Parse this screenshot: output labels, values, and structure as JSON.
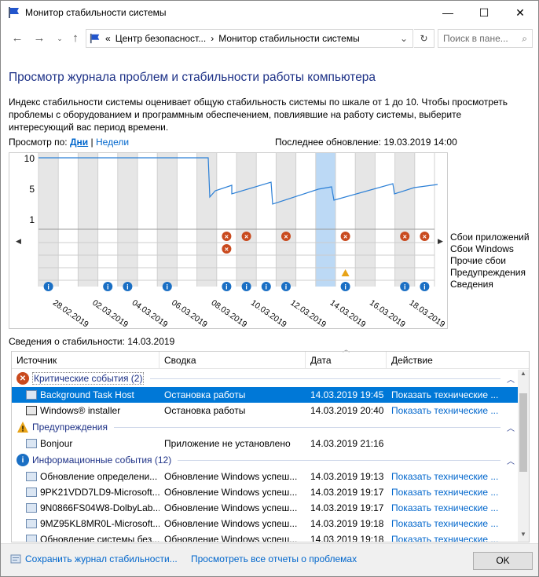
{
  "window": {
    "title": "Монитор стабильности системы"
  },
  "titlebar": {
    "minimize": "—",
    "maximize": "☐",
    "close": "✕"
  },
  "nav": {
    "breadcrumb_sep": "«",
    "crumb1": "Центр безопасност...",
    "crumb2": "Монитор стабильности системы",
    "search_placeholder": "Поиск в пане..."
  },
  "heading": "Просмотр журнала проблем и стабильности работы компьютера",
  "description": "Индекс стабильности системы оценивает общую стабильность системы по шкале от 1 до 10. Чтобы просмотреть проблемы с оборудованием и программным обеспечением, повлиявшие на работу системы, выберите интересующий вас период времени.",
  "viewby": {
    "label": "Просмотр по:",
    "days": "Дни",
    "sep": "|",
    "weeks": "Недели"
  },
  "last_update": "Последнее обновление: 19.03.2019 14:00",
  "chart": {
    "y_ticks": [
      "10",
      "5",
      "1"
    ],
    "dates": [
      "28.02.2019",
      "02.03.2019",
      "04.03.2019",
      "06.03.2019",
      "08.03.2019",
      "10.03.2019",
      "12.03.2019",
      "14.03.2019",
      "16.03.2019",
      "18.03.2019"
    ],
    "legend": [
      "Сбои приложений",
      "Сбои Windows",
      "Прочие сбои",
      "Предупреждения",
      "Сведения"
    ]
  },
  "details_label": "Сведения о стабильности: 14.03.2019",
  "table": {
    "columns": [
      "Источник",
      "Сводка",
      "Дата",
      "Действие"
    ],
    "groups": {
      "critical": "Критические события (2)",
      "warnings": "Предупреждения",
      "info": "Информационные события (12)"
    },
    "critical_rows": [
      {
        "source": "Background Task Host",
        "summary": "Остановка работы",
        "date": "14.03.2019 19:45",
        "action": "Показать технические ..."
      },
      {
        "source": "Windows® installer",
        "summary": "Остановка работы",
        "date": "14.03.2019 20:40",
        "action": "Показать технические ..."
      }
    ],
    "warning_rows": [
      {
        "source": "Bonjour",
        "summary": "Приложение не установлено",
        "date": "14.03.2019 21:16",
        "action": ""
      }
    ],
    "info_rows": [
      {
        "source": "Обновление определени...",
        "summary": "Обновление Windows успеш...",
        "date": "14.03.2019 19:13",
        "action": "Показать технические ..."
      },
      {
        "source": "9PK21VDD7LD9-Microsoft...",
        "summary": "Обновление Windows успеш...",
        "date": "14.03.2019 19:17",
        "action": "Показать технические ..."
      },
      {
        "source": "9N0866FS04W8-DolbyLab...",
        "summary": "Обновление Windows успеш...",
        "date": "14.03.2019 19:17",
        "action": "Показать технические ..."
      },
      {
        "source": "9MZ95KL8MR0L-Microsoft...",
        "summary": "Обновление Windows успеш...",
        "date": "14.03.2019 19:18",
        "action": "Показать технические ..."
      },
      {
        "source": "Обновление системы без...",
        "summary": "Обновление Windows успеш...",
        "date": "14.03.2019 19:18",
        "action": "Показать технические ..."
      }
    ]
  },
  "footer": {
    "save_link": "Сохранить журнал стабильности...",
    "all_reports_link": "Просмотреть все отчеты о проблемах",
    "ok": "OK"
  },
  "colors": {
    "accent": "#0078d7",
    "error": "#c94a1e",
    "warning": "#e8a317",
    "info": "#1a6fc4",
    "line": "#2b7fd6",
    "selected_col": "#bcd9f5"
  }
}
